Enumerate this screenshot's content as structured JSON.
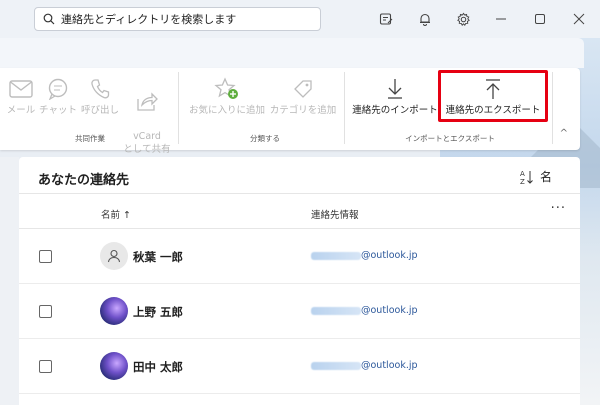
{
  "search": {
    "placeholder": "連絡先とディレクトリを検索します"
  },
  "ribbon": {
    "share_group": {
      "label": "共同作業",
      "items": [
        {
          "label": "メール",
          "icon": "mail-icon"
        },
        {
          "label": "チャット",
          "icon": "chat-icon"
        },
        {
          "label": "呼び出し",
          "icon": "phone-icon"
        },
        {
          "label": "vCard\nとして共有",
          "icon": "share-icon"
        }
      ]
    },
    "classify_group": {
      "label": "分類する",
      "items": [
        {
          "label": "お気に入りに追加",
          "icon": "star-add-icon"
        },
        {
          "label": "カテゴリを追加",
          "icon": "tag-icon"
        }
      ]
    },
    "import_export_group": {
      "label": "インポートとエクスポート",
      "items": [
        {
          "label": "連絡先のインポート",
          "icon": "import-icon"
        },
        {
          "label": "連絡先のエクスポート",
          "icon": "export-icon"
        }
      ]
    }
  },
  "panel": {
    "title": "あなたの連絡先",
    "sort_label": "名",
    "columns": {
      "name": "名前 ↑",
      "info": "連絡先情報",
      "more": "···"
    },
    "contacts": [
      {
        "name": "秋葉 一郎",
        "email_domain": "@outlook.jp",
        "avatar": "default"
      },
      {
        "name": "上野 五郎",
        "email_domain": "@outlook.jp",
        "avatar": "photo"
      },
      {
        "name": "田中 太郎",
        "email_domain": "@outlook.jp",
        "avatar": "photo"
      }
    ]
  },
  "colors": {
    "highlight": "#e60012",
    "link": "#2b579a"
  }
}
